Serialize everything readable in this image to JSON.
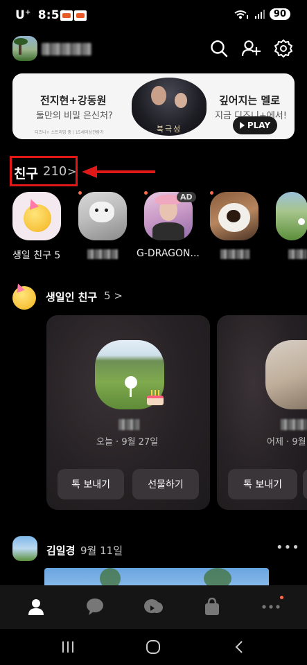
{
  "status_bar": {
    "carrier": "U",
    "carrier_sup": "+",
    "time": "8:59",
    "battery": "90"
  },
  "banner": {
    "left_title": "전지현+강동원",
    "left_subtitle": "둘만의 비밀 은신처?",
    "left_footnote": "디즈니+ 스트리밍 중 | 15세이상관람가",
    "poster_title": "북극성",
    "right_title": "깊어지는 멜로",
    "right_subtitle": "지금 디즈니+에서!",
    "play_label": "PLAY"
  },
  "friends": {
    "title": "친구",
    "count": "210",
    "chevron": ">",
    "stories": [
      {
        "label": "생일 친구 5"
      },
      {
        "label": ""
      },
      {
        "label": "G-DRAGON..."
      },
      {
        "label": ""
      },
      {
        "label": ""
      }
    ],
    "ad_badge": "AD"
  },
  "birthday": {
    "title": "생일인 친구",
    "count": "5",
    "chevron": ">",
    "cards": [
      {
        "date": "오늘 · 9월 27일",
        "send_talk": "톡 보내기",
        "send_gift": "선물하기"
      },
      {
        "date": "어제 · 9월",
        "send_talk": "톡 보내기"
      }
    ]
  },
  "feed": {
    "name": "김일경",
    "date": "9월 11일",
    "more": "•••"
  },
  "colors": {
    "highlight_red": "#e01818",
    "accent_dot": "#ff6b4a"
  },
  "icons": [
    "search-icon",
    "add-friend-icon",
    "settings-icon",
    "friends-tab-icon",
    "chat-tab-icon",
    "openchat-tab-icon",
    "shopping-tab-icon",
    "more-tab-icon"
  ]
}
